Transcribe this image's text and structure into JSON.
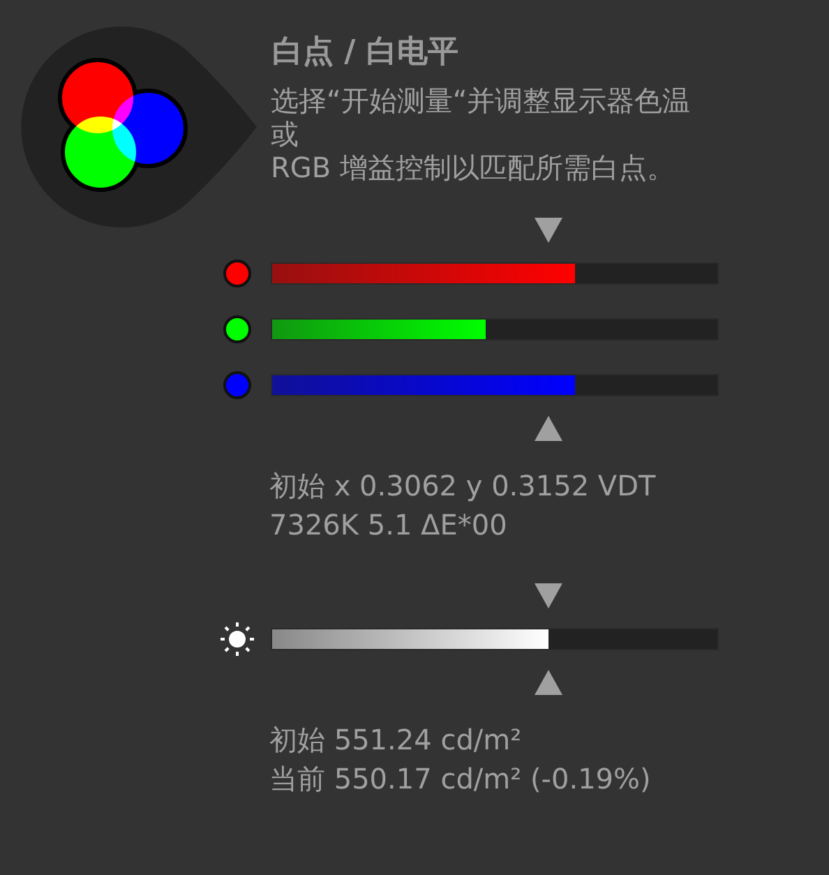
{
  "title": "白点 / 白电平",
  "description": [
    "选择“开始测量“并调整显示器色温",
    "或",
    "RGB 增益控制以匹配所需白点。"
  ],
  "meters": [
    {
      "kind": "channels",
      "bars": [
        {
          "color": "#ff0000",
          "level": 0.68
        },
        {
          "color": "#00ff00",
          "level": 0.48
        },
        {
          "color": "#0000ff",
          "level": 0.68
        }
      ],
      "readings": [
        "初始 x 0.3062 y 0.3152 VDT",
        "7326K 5.1 ΔE*00"
      ]
    },
    {
      "kind": "brightness",
      "bars": [
        {
          "color": "#ffffff",
          "level": 0.62
        }
      ],
      "readings": [
        "初始 551.24 cd/m²",
        "当前 550.17 cd/m² (-0.19%)"
      ]
    }
  ]
}
